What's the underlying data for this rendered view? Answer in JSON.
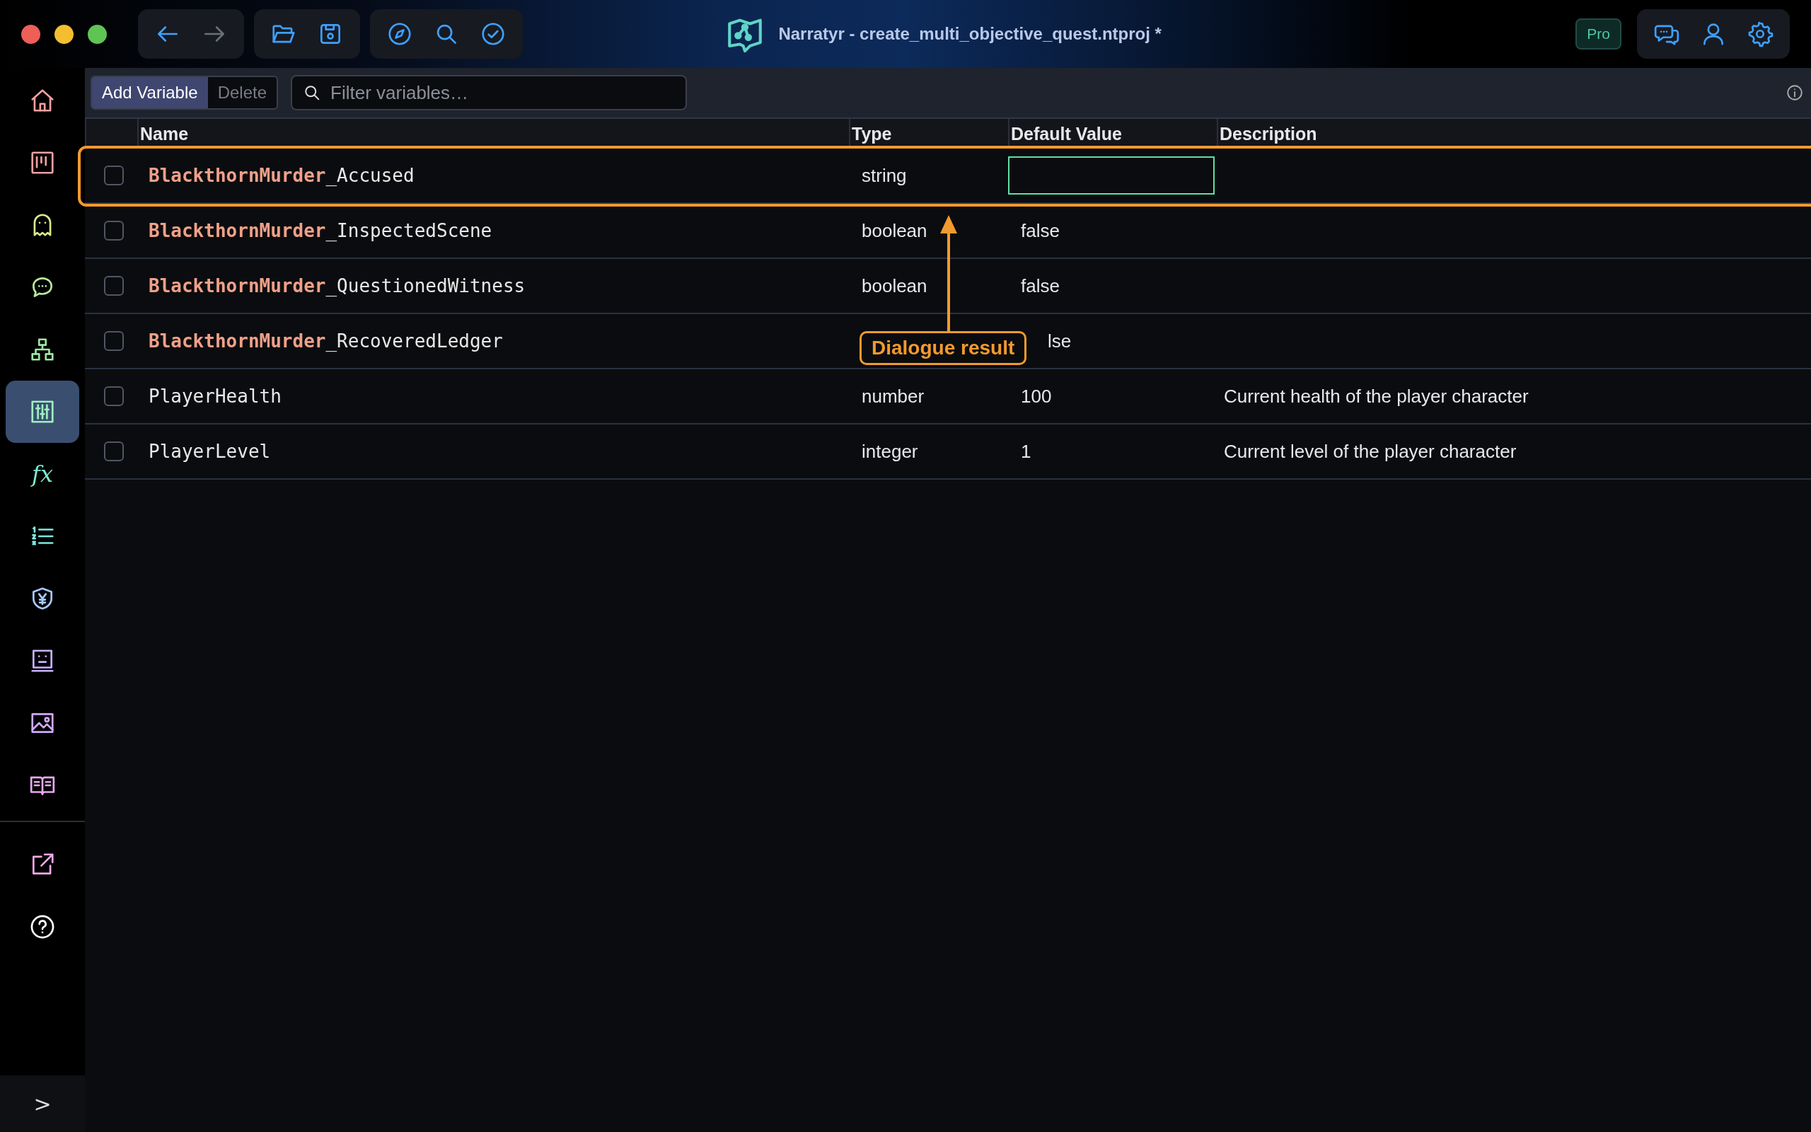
{
  "window": {
    "title": "Narratyr - create_multi_objective_quest.ntproj *"
  },
  "toolbar_groups": [
    [
      {
        "disabled": false
      },
      {
        "disabled": true
      }
    ],
    [
      {
        "disabled": false
      },
      {
        "disabled": false
      }
    ],
    [
      {
        "disabled": false
      },
      {
        "disabled": false
      },
      {
        "disabled": false
      }
    ]
  ],
  "plan_badge": "Pro",
  "sidebar": {
    "items": [
      {
        "selected": false
      },
      {
        "selected": false
      },
      {
        "selected": false
      },
      {
        "selected": false
      },
      {
        "selected": false
      },
      {
        "selected": true
      },
      {
        "text": "fx",
        "selected": false
      },
      {
        "selected": false
      },
      {
        "selected": false
      },
      {
        "selected": false
      },
      {
        "selected": false
      },
      {
        "selected": false
      }
    ],
    "footer_items": [
      {
        "selected": false
      },
      {
        "selected": false
      }
    ],
    "expand_label": ">"
  },
  "actions": [
    {
      "label": "Add Variable",
      "disabled": false
    },
    {
      "label": "Delete",
      "disabled": true
    }
  ],
  "search": {
    "placeholder": "Filter variables…"
  },
  "table": {
    "columns": [
      "Name",
      "Type",
      "Default Value",
      "Description"
    ],
    "rows": [
      {
        "checked": false,
        "name": "**BlackthornMurder**_Accused",
        "type": "string",
        "editing": true,
        "highlighted": true
      },
      {
        "checked": false,
        "name": "**BlackthornMurder**_InspectedScene",
        "type": "boolean",
        "default_value": "false",
        "highlighted": false
      },
      {
        "checked": false,
        "name": "**BlackthornMurder**_QuestionedWitness",
        "type": "boolean",
        "default_value": "false",
        "highlighted": false
      },
      {
        "checked": false,
        "name": "**BlackthornMurder**_RecoveredLedger",
        "default_value": "lse",
        "highlighted": false
      },
      {
        "checked": false,
        "name": "PlayerHealth",
        "type": "number",
        "default_value": "100",
        "description": "Current health of the player character",
        "highlighted": false
      },
      {
        "checked": false,
        "name": "PlayerLevel",
        "type": "integer",
        "default_value": "1",
        "description": "Current level of the player character",
        "highlighted": false
      }
    ]
  },
  "annotation": {
    "label": "Dialogue result"
  }
}
